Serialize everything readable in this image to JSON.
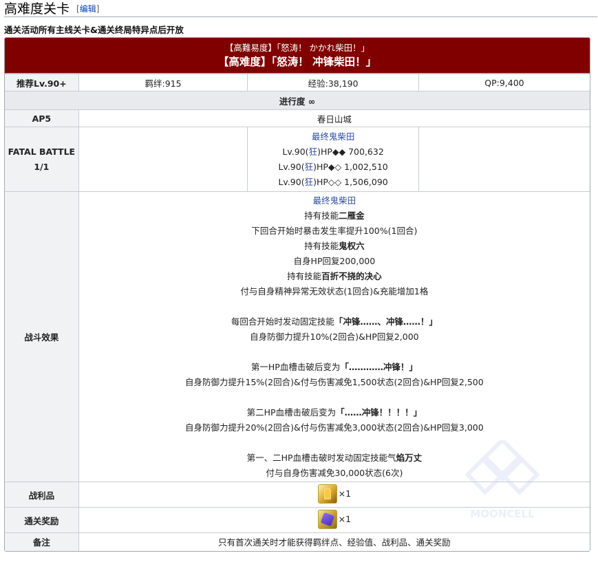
{
  "section": {
    "title": "高难度关卡",
    "edit_open": "[",
    "edit_label": "编辑",
    "edit_close": "]"
  },
  "subtitle": "通关活动所有主线关卡&通关终局特异点后开放",
  "quest": {
    "banner_jp": "【高難易度】「怒涛！ かかれ柴田！」",
    "banner_cn": "【高难度】「怒涛！ 冲锋柴田！」",
    "recommend": "推荐Lv.90+",
    "bond": "羁绊:915",
    "exp": "经验:38,190",
    "qp": "QP:9,400",
    "progress": "进行度 ∞",
    "ap": "AP5",
    "location": "春日山城",
    "battle_label_1": "FATAL BATTLE",
    "battle_label_2": "1/1",
    "enemy": {
      "name": "最终鬼柴田",
      "hp_lines": [
        {
          "pre": "Lv.90(",
          "cls": "狂",
          "post": ")HP◆◆ 700,632"
        },
        {
          "pre": "Lv.90(",
          "cls": "狂",
          "post": ")HP◆◇ 1,002,510"
        },
        {
          "pre": "Lv.90(",
          "cls": "狂",
          "post": ")HP◇◇ 1,506,090"
        }
      ]
    },
    "effects_label": "战斗效果",
    "effects": {
      "name": "最终鬼柴田",
      "skill1_pre": "持有技能",
      "skill1_name": "二雁金",
      "skill1_desc": "下回合开始时暴击发生率提升100%(1回合)",
      "skill2_pre": "持有技能",
      "skill2_name": "鬼权六",
      "skill2_desc": "自身HP回复200,000",
      "skill3_pre": "持有技能",
      "skill3_name": "百折不挠的决心",
      "skill3_desc": "付与自身精神异常无效状态(1回合)&充能增加1格",
      "fixed1_pre": "每回合开始时发动固定技能",
      "fixed1_name": "「冲锋……、冲锋……！」",
      "fixed1_desc": "自身防御力提升10%(2回合)&HP回复2,000",
      "break1_pre": "第一HP血槽击破后变为",
      "break1_name": "「…………冲锋！」",
      "break1_desc": "自身防御力提升15%(2回合)&付与伤害减免1,500状态(2回合)&HP回复2,500",
      "break2_pre": "第二HP血槽击破后变为",
      "break2_name": "「……冲锋！！！！」",
      "break2_desc": "自身防御力提升20%(2回合)&付与伤害减免3,000状态(2回合)&HP回复3,000",
      "final_pre": "第一、二HP血槽击破时发动固定技能气",
      "final_name": "焰万丈",
      "final_desc": "付与自身伤害减免30,000状态(6次)"
    },
    "loot_label": "战利品",
    "loot_qty": "×1",
    "reward_label": "通关奖励",
    "reward_qty": "×1",
    "note_label": "备注",
    "note": "只有首次通关时才能获得羁绊点、经验值、战利品、通关奖励"
  },
  "watermark_text": "MOONCELL",
  "colors": {
    "banner_bg": "#800000",
    "link": "#2b4ea0",
    "label_bg": "#f1f2f4"
  }
}
